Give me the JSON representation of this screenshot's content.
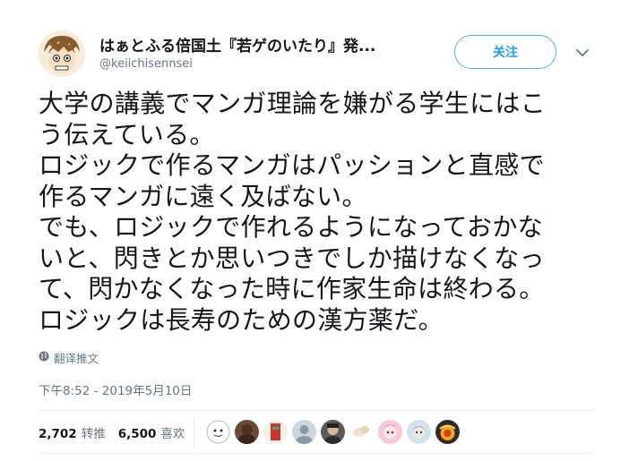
{
  "tweet": {
    "author": {
      "display_name": "はぁとふる倍国土『若ゲのいたり』発...",
      "handle": "@keiichisennsei"
    },
    "follow_label": "关注",
    "text_lines": [
      "大学の講義でマンガ理論を嫌がる学生にはこ",
      "う伝えている。",
      "ロジックで作るマンガはパッションと直感で",
      "作るマンガに遠く及ばない。",
      "でも、ロジックで作れるようになっておかな",
      "いと、閃きとか思いつきでしか描けなくなっ",
      "て、閃かなくなった時に作家生命は終わる。",
      "ロジックは長寿のための漢方薬だ。"
    ],
    "translate_label": "翻译推文",
    "timestamp": "下午8:52 - 2019年5月10日",
    "stats": {
      "retweets_count": "2,702",
      "retweets_label": "转推",
      "likes_count": "6,500",
      "likes_label": "喜欢"
    }
  },
  "colors": {
    "accent": "#1da1f2",
    "muted_text": "#657786",
    "divider": "#e6ecf0"
  },
  "icons": {
    "globe": "globe-icon",
    "caret": "chevron-down-icon"
  }
}
